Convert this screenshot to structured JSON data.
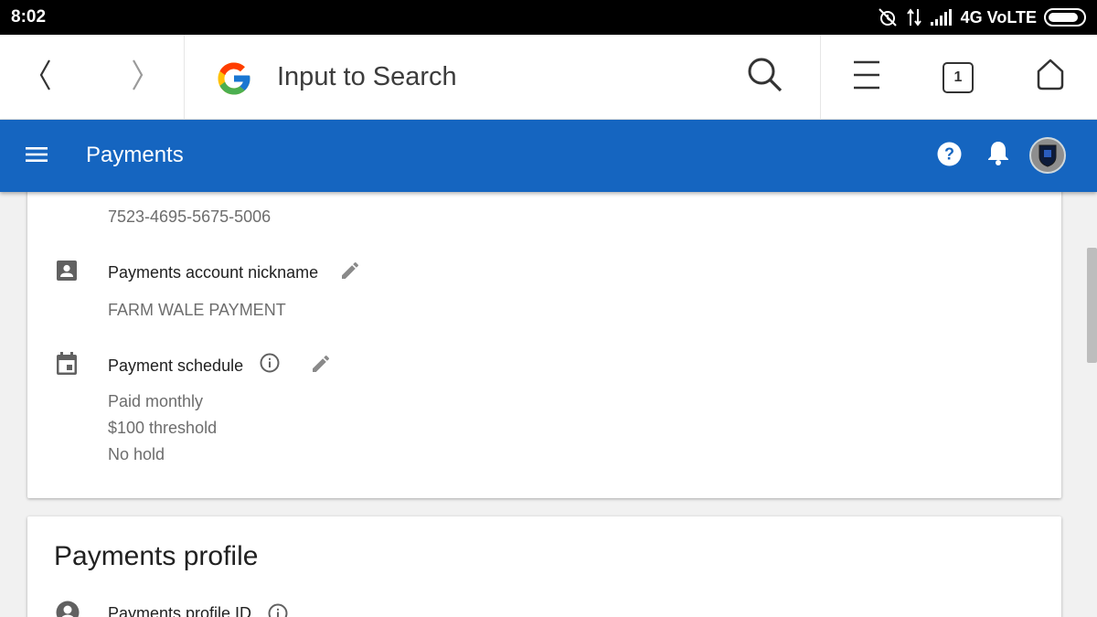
{
  "status_bar": {
    "time": "8:02",
    "network": "4G VoLTE",
    "battery_level": 0.9
  },
  "browser": {
    "search_placeholder": "Input to Search",
    "tab_count": "1",
    "icons": [
      "back-icon",
      "forward-icon",
      "google-logo",
      "search-icon",
      "menu-icon",
      "tabs-icon",
      "home-icon"
    ]
  },
  "app_bar": {
    "title": "Payments"
  },
  "account_card": {
    "account_id": "7523-4695-5675-5006",
    "nickname_label": "Payments account nickname",
    "nickname_value": "FARM WALE PAYMENT",
    "schedule_label": "Payment schedule",
    "schedule_lines": [
      "Paid monthly",
      "$100 threshold",
      "No hold"
    ]
  },
  "profile_card": {
    "heading": "Payments profile",
    "profile_id_label": "Payments profile ID"
  },
  "colors": {
    "app_bar": "#1565c0",
    "icon_grey": "#616161",
    "text_secondary": "#6d6d6d"
  }
}
